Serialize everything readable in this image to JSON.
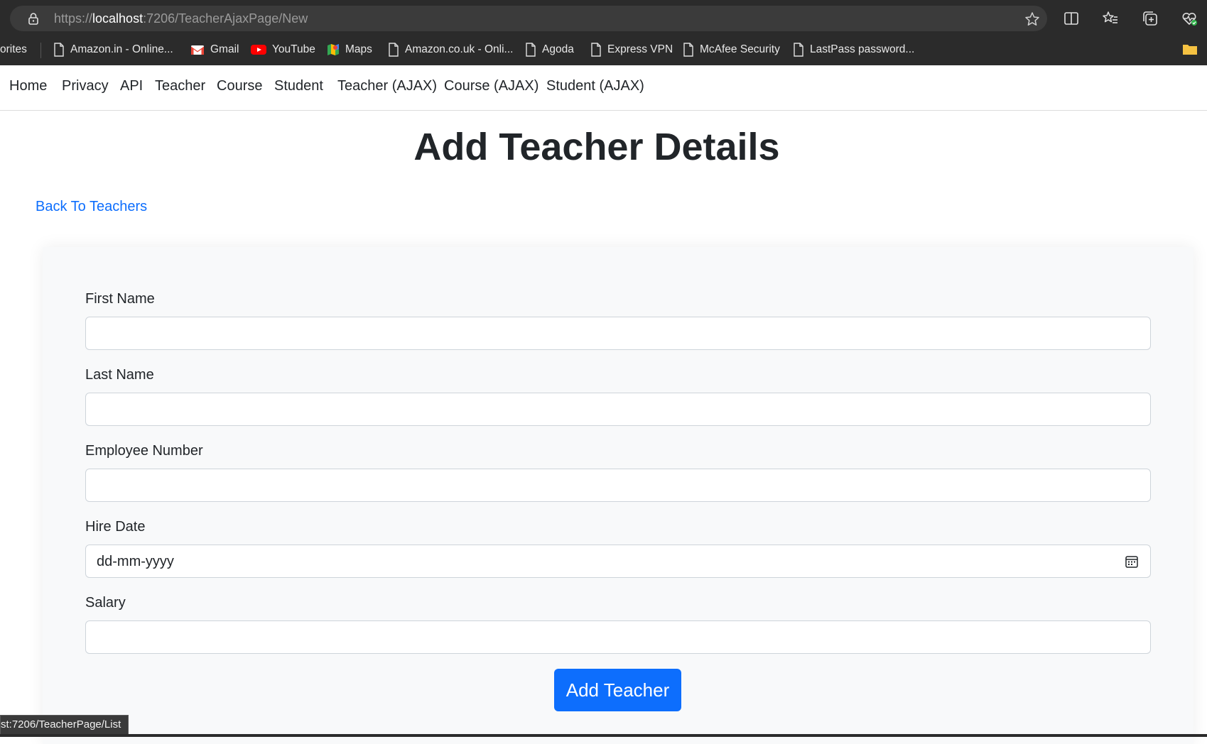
{
  "browser": {
    "url_scheme": "https://",
    "url_host": "localhost",
    "url_rest": ":7206/TeacherAjaxPage/New",
    "bookmarks": [
      {
        "label": "orites",
        "icon": "none"
      },
      {
        "label": "Amazon.in - Online...",
        "icon": "page-icon"
      },
      {
        "label": "Gmail",
        "icon": "gmail-icon"
      },
      {
        "label": "YouTube",
        "icon": "youtube-icon"
      },
      {
        "label": "Maps",
        "icon": "maps-icon"
      },
      {
        "label": "Amazon.co.uk - Onli...",
        "icon": "page-icon"
      },
      {
        "label": "Agoda",
        "icon": "page-icon"
      },
      {
        "label": "Express VPN",
        "icon": "page-icon"
      },
      {
        "label": "McAfee Security",
        "icon": "page-icon"
      },
      {
        "label": "LastPass password...",
        "icon": "page-icon"
      }
    ],
    "status_url": "st:7206/TeacherPage/List"
  },
  "nav": {
    "items": [
      "Home",
      "Privacy",
      "API",
      "Teacher",
      "Course",
      "Student",
      "Teacher (AJAX)",
      "Course (AJAX)",
      "Student (AJAX)"
    ]
  },
  "page": {
    "title": "Add Teacher Details",
    "back_link": "Back To Teachers"
  },
  "form": {
    "fields": [
      {
        "label": "First Name",
        "value": "",
        "type": "text"
      },
      {
        "label": "Last Name",
        "value": "",
        "type": "text"
      },
      {
        "label": "Employee Number",
        "value": "",
        "type": "text"
      },
      {
        "label": "Hire Date",
        "value": "dd-mm-yyyy",
        "type": "date"
      },
      {
        "label": "Salary",
        "value": "",
        "type": "text"
      }
    ],
    "submit_label": "Add Teacher"
  },
  "colors": {
    "primary": "#0d6efd",
    "text": "#212529",
    "chrome": "#2b2b2b"
  }
}
